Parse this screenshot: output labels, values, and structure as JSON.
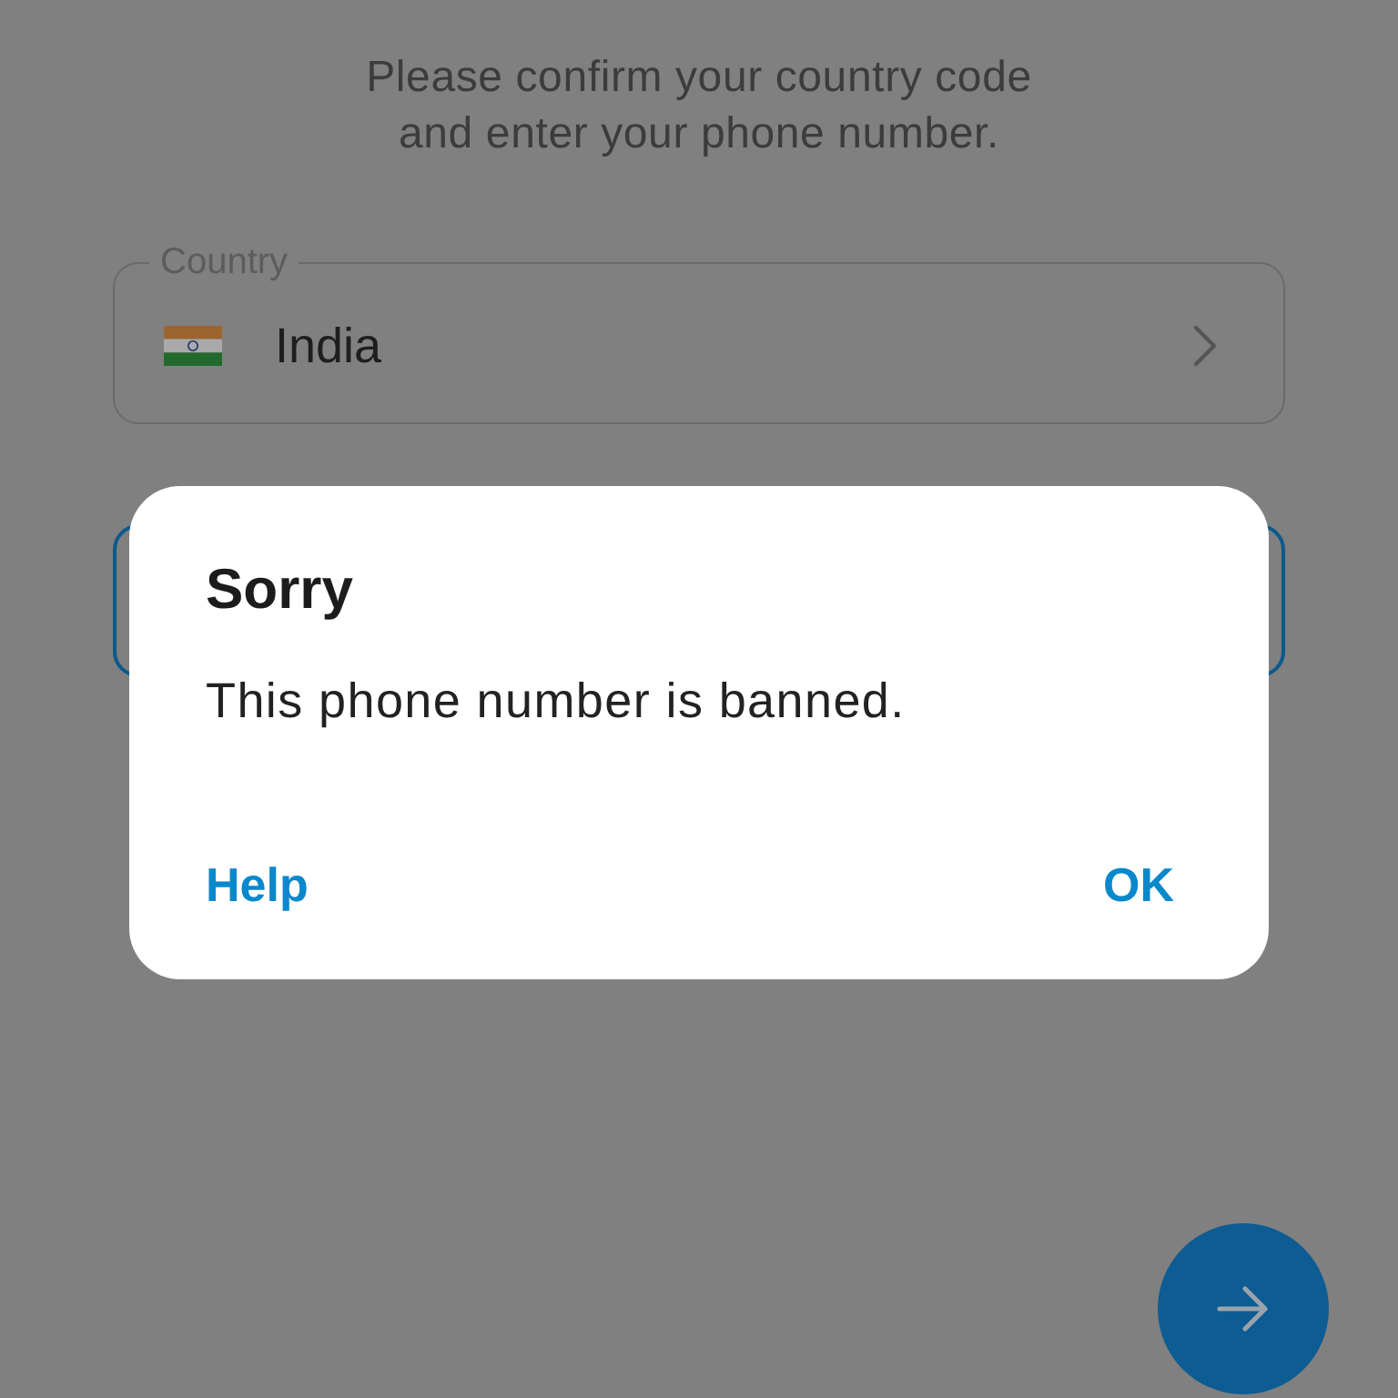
{
  "intro": {
    "subtitle": "Please confirm your country code and enter your phone number."
  },
  "country_field": {
    "label": "Country",
    "value": "India"
  },
  "phone_field": {
    "focused": true
  },
  "dialog": {
    "title": "Sorry",
    "message": "This phone number is banned.",
    "buttons": [
      "Help",
      "OK"
    ]
  }
}
